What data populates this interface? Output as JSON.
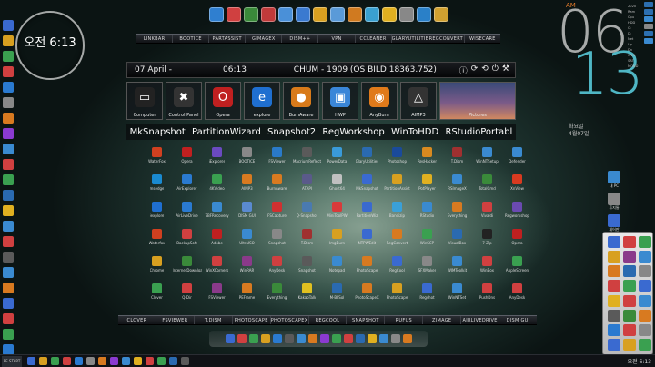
{
  "colors": {
    "accent_cyan": "#4fb6c4",
    "ampm_orange": "#e07a2a"
  },
  "clock_widget": {
    "label": "오전 6:13"
  },
  "top_quick_launch": [
    {
      "icon": "app-icon",
      "color": "#2f7fd0"
    },
    {
      "icon": "app-icon",
      "color": "#d04040"
    },
    {
      "icon": "app-icon",
      "color": "#3a8a3a"
    },
    {
      "icon": "app-icon",
      "color": "#c03a3a"
    },
    {
      "icon": "app-icon",
      "color": "#4a90d8"
    },
    {
      "icon": "app-icon",
      "color": "#3a7ad0"
    },
    {
      "icon": "app-icon",
      "color": "#d8a020"
    },
    {
      "icon": "app-icon",
      "color": "#5a9ad8"
    },
    {
      "icon": "app-icon",
      "color": "#d07a20"
    },
    {
      "icon": "app-icon",
      "color": "#3aa0d0"
    },
    {
      "icon": "app-icon",
      "color": "#e0b020"
    },
    {
      "icon": "app-icon",
      "color": "#888888"
    },
    {
      "icon": "app-icon",
      "color": "#2a80c8"
    },
    {
      "icon": "app-icon",
      "color": "#d0a030"
    }
  ],
  "top_bar": [
    "LINKBAR",
    "BOOTICE",
    "PARTASSIST",
    "GIMAGEX",
    "DISM++",
    "VPN",
    "CCLEANER",
    "GLARYUTILITIES",
    "REGCONVERT",
    "WISECARE"
  ],
  "info_bar": {
    "date": "07  April  -",
    "time": "06:13",
    "build": "CHUM - 1909 (OS BILD 18363.752)",
    "controls": [
      "ⓘ",
      "⟳",
      "⟲",
      "⏻",
      "⚒"
    ]
  },
  "tiles": [
    {
      "label": "Computer",
      "glyph": "▭",
      "color": "#222"
    },
    {
      "label": "Control Panel",
      "glyph": "✖",
      "color": "#333"
    },
    {
      "label": "Opera",
      "glyph": "O",
      "color": "#c02020"
    },
    {
      "label": "explore",
      "glyph": "e",
      "color": "#1f6fd0"
    },
    {
      "label": "BumAware",
      "glyph": "●",
      "color": "#d87a1a"
    },
    {
      "label": "HWP",
      "glyph": "▣",
      "color": "#3a86d8"
    },
    {
      "label": "AnyBurn",
      "glyph": "◉",
      "color": "#e07a1a"
    },
    {
      "label": "AIMP3",
      "glyph": "△",
      "color": "#333"
    },
    {
      "label": "Pictures",
      "glyph": "",
      "color": "transparent"
    }
  ],
  "text_launcher": [
    "MkSnapshot",
    "PartitionWizard",
    "Snapshot2",
    "RegWorkshop",
    "WinToHDD",
    "RStudioPortabl"
  ],
  "desktop_icons": [
    {
      "label": "WaterFox",
      "color": "#d04020"
    },
    {
      "label": "Opera",
      "color": "#c02020"
    },
    {
      "label": "iExplorer",
      "color": "#6a4ac0"
    },
    {
      "label": "BOOTICE",
      "color": "#888"
    },
    {
      "label": "FSViewer",
      "color": "#2a7ac8"
    },
    {
      "label": "MacriumReflect",
      "color": "#5a5a5a"
    },
    {
      "label": "PowerData",
      "color": "#3a9ad8"
    },
    {
      "label": "GlaryUtilities",
      "color": "#2a6ab0"
    },
    {
      "label": "Photoshop",
      "color": "#1a4a9a"
    },
    {
      "label": "ResHacker",
      "color": "#d88a20"
    },
    {
      "label": "T.Dism",
      "color": "#a03030"
    },
    {
      "label": "WinNTSetup",
      "color": "#3a8ad0"
    },
    {
      "label": "Defender",
      "color": "#3a8ad0"
    },
    {
      "label": "msedge",
      "color": "#1a8ad0"
    },
    {
      "label": "AirExplorer",
      "color": "#2a7ad0"
    },
    {
      "label": "4KVideo",
      "color": "#3aa050"
    },
    {
      "label": "AIMP3",
      "color": "#d87a20"
    },
    {
      "label": "BurnAware",
      "color": "#d87a20"
    },
    {
      "label": "ATAPI",
      "color": "#5a5a8a"
    },
    {
      "label": "Ghost64",
      "color": "#c0c0c0"
    },
    {
      "label": "MkSnapshot",
      "color": "#3a6ad0"
    },
    {
      "label": "PartitionAssist",
      "color": "#d8a020"
    },
    {
      "label": "PotPlayer",
      "color": "#e0b020"
    },
    {
      "label": "RSImageX",
      "color": "#3a8ad0"
    },
    {
      "label": "TotalCmd",
      "color": "#3a8a3a"
    },
    {
      "label": "XnView",
      "color": "#d83a20"
    },
    {
      "label": "iexplore",
      "color": "#1f6fd0"
    },
    {
      "label": "AirLiveDrive",
      "color": "#2a7ad0"
    },
    {
      "label": "7BFRecovery",
      "color": "#3a8ad0"
    },
    {
      "label": "DISM GUI",
      "color": "#5a8ad0"
    },
    {
      "label": "FSCapture",
      "color": "#d03030"
    },
    {
      "label": "Q-Snapshot",
      "color": "#4a7ab0"
    },
    {
      "label": "MiniToolPW",
      "color": "#d83a3a"
    },
    {
      "label": "PartitionWiz",
      "color": "#3a6ad0"
    },
    {
      "label": "Bandizip",
      "color": "#3aa0d8"
    },
    {
      "label": "RStudio",
      "color": "#3a8ad0"
    },
    {
      "label": "Everything",
      "color": "#d87a20"
    },
    {
      "label": "Vivaldi",
      "color": "#d04040"
    },
    {
      "label": "Regworkshop",
      "color": "#6a4ab0"
    },
    {
      "label": "Waterfox",
      "color": "#d04020"
    },
    {
      "label": "BackupSoft",
      "color": "#d04040"
    },
    {
      "label": "Adobe",
      "color": "#c02020"
    },
    {
      "label": "UltraISO",
      "color": "#3a8ad0"
    },
    {
      "label": "Snapshot",
      "color": "#888"
    },
    {
      "label": "T.Dism",
      "color": "#a03030"
    },
    {
      "label": "ImgBurn",
      "color": "#d8a020"
    },
    {
      "label": "NTPWEdit",
      "color": "#3a6ad0"
    },
    {
      "label": "RegConvert",
      "color": "#d87a20"
    },
    {
      "label": "WinSCP",
      "color": "#3aa050"
    },
    {
      "label": "VisualBox",
      "color": "#2a6ab0"
    },
    {
      "label": "7-Zip",
      "color": "#222"
    },
    {
      "label": "Opera",
      "color": "#c02020"
    },
    {
      "label": "Chrome",
      "color": "#d8a020"
    },
    {
      "label": "InternetDownload",
      "color": "#3a8a3a"
    },
    {
      "label": "WinXCorners",
      "color": "#d04040"
    },
    {
      "label": "WinRAR",
      "color": "#8a3a8a"
    },
    {
      "label": "AnyDesk",
      "color": "#d04040"
    },
    {
      "label": "Snapshot",
      "color": "#5a5a5a"
    },
    {
      "label": "Notepad",
      "color": "#3a8ad0"
    },
    {
      "label": "PhotoScape",
      "color": "#d87a20"
    },
    {
      "label": "RegCool",
      "color": "#3a6ad0"
    },
    {
      "label": "SFXMaker",
      "color": "#888"
    },
    {
      "label": "WIMToolkit",
      "color": "#3a8ad0"
    },
    {
      "label": "WinBox",
      "color": "#d04040"
    },
    {
      "label": "AppleScreen",
      "color": "#3aa050"
    },
    {
      "label": "Clover",
      "color": "#3aa050"
    },
    {
      "label": "Q-Dir",
      "color": "#d04040"
    },
    {
      "label": "FSViewer",
      "color": "#8a3a8a"
    },
    {
      "label": "PEFrame",
      "color": "#d87a20"
    },
    {
      "label": "Everything",
      "color": "#3a8a3a"
    },
    {
      "label": "KakaoTalk",
      "color": "#e0c020"
    },
    {
      "label": "M-BFSol",
      "color": "#2a6ab0"
    },
    {
      "label": "PhotoScapeX",
      "color": "#d87a20"
    },
    {
      "label": "PhotoScape",
      "color": "#d8a020"
    },
    {
      "label": "Regshot",
      "color": "#3a6ad0"
    },
    {
      "label": "WinNTSet",
      "color": "#3a8ad0"
    },
    {
      "label": "PushDns",
      "color": "#d04040"
    },
    {
      "label": "AnyDesk",
      "color": "#d04040"
    }
  ],
  "bottom_bar": [
    "CLOVER",
    "FSVIEWER",
    "T.DISM",
    "PHOTOSCAPE",
    "PHOTOSCAPEX",
    "REGCOOL",
    "SNAPSHOT",
    "RUFUS",
    "ZIMAGE",
    "AIRLIVEDRIVE",
    "DISM GUI"
  ],
  "dock": [
    "#3a6ad0",
    "#d04040",
    "#3aa050",
    "#d8a020",
    "#2a7ad0",
    "#5a5a5a",
    "#3a8ad0",
    "#d87a20",
    "#8a3ad0",
    "#3aa050",
    "#d04040",
    "#2a6ab0",
    "#e0b020",
    "#3a8ad0",
    "#888888",
    "#d87a20"
  ],
  "big_clock": {
    "ampm": "AM",
    "hour": "06",
    "minute": "13",
    "day_line1": "화요일",
    "day_line2": "4월07일"
  },
  "right_stats": [
    "2020",
    "Ram",
    "Cpu",
    "HDD",
    "C:",
    "D:",
    "Net",
    "Up",
    "Dn",
    "W23",
    "SAT",
    "MOND"
  ],
  "right_desktop": [
    {
      "label": "내 PC",
      "color": "#3a8ad0"
    },
    {
      "label": "휴지통",
      "color": "#888"
    },
    {
      "label": "제어판",
      "color": "#3a6ad0"
    }
  ],
  "panel_icons": [
    "#3a6ad0",
    "#d04040",
    "#3aa050",
    "#d8a020",
    "#8a3a8a",
    "#3a8ad0",
    "#d87a20",
    "#2a6ab0",
    "#888",
    "#d04040",
    "#3aa050",
    "#3a6ad0",
    "#e0b020",
    "#d04040",
    "#3a8ad0",
    "#5a5a5a",
    "#3a8a3a",
    "#d87a20",
    "#2a7ad0",
    "#d04040",
    "#888888",
    "#3a6ad0",
    "#d8a020",
    "#3aa050"
  ],
  "taskbar": {
    "start_label": "PE START",
    "icons": [
      "#3a6ad0",
      "#d8a020",
      "#3aa050",
      "#d04040",
      "#2a7ad0",
      "#888888",
      "#d87a20",
      "#8a3ad0",
      "#3a8ad0",
      "#e0b020",
      "#d04040",
      "#3aa050",
      "#2a6ab0",
      "#5a5a5a"
    ],
    "tray_time": "오전 6:13"
  }
}
